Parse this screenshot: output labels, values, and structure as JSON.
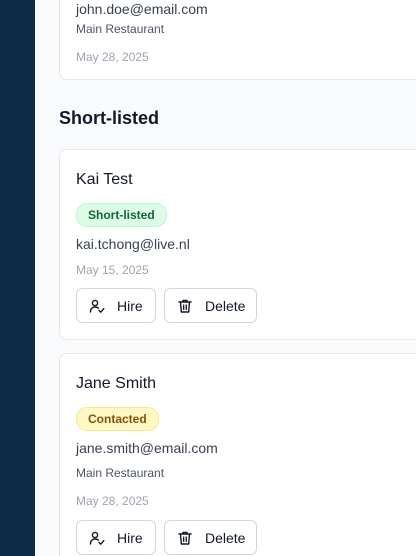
{
  "previous_card": {
    "email": "john.doe@email.com",
    "location": "Main Restaurant",
    "date": "May 28, 2025"
  },
  "section": {
    "title": "Short-listed"
  },
  "candidates": [
    {
      "name": "Kai Test",
      "status": "Short-listed",
      "email": "kai.tchong@live.nl",
      "date": "May 15, 2025"
    },
    {
      "name": "Jane Smith",
      "status": "Contacted",
      "email": "jane.smith@email.com",
      "location": "Main Restaurant",
      "date": "May 28, 2025"
    }
  ],
  "actions": {
    "hire_label": "Hire",
    "delete_label": "Delete"
  },
  "icons": {
    "hire": "user-check-icon",
    "delete": "trash-icon"
  },
  "colors": {
    "sidebar": "#0d2b45",
    "shortlisted_badge_bg": "#dcfce7",
    "shortlisted_badge_text": "#166534",
    "contacted_badge_bg": "#fef9c3",
    "contacted_badge_text": "#854d0e"
  }
}
